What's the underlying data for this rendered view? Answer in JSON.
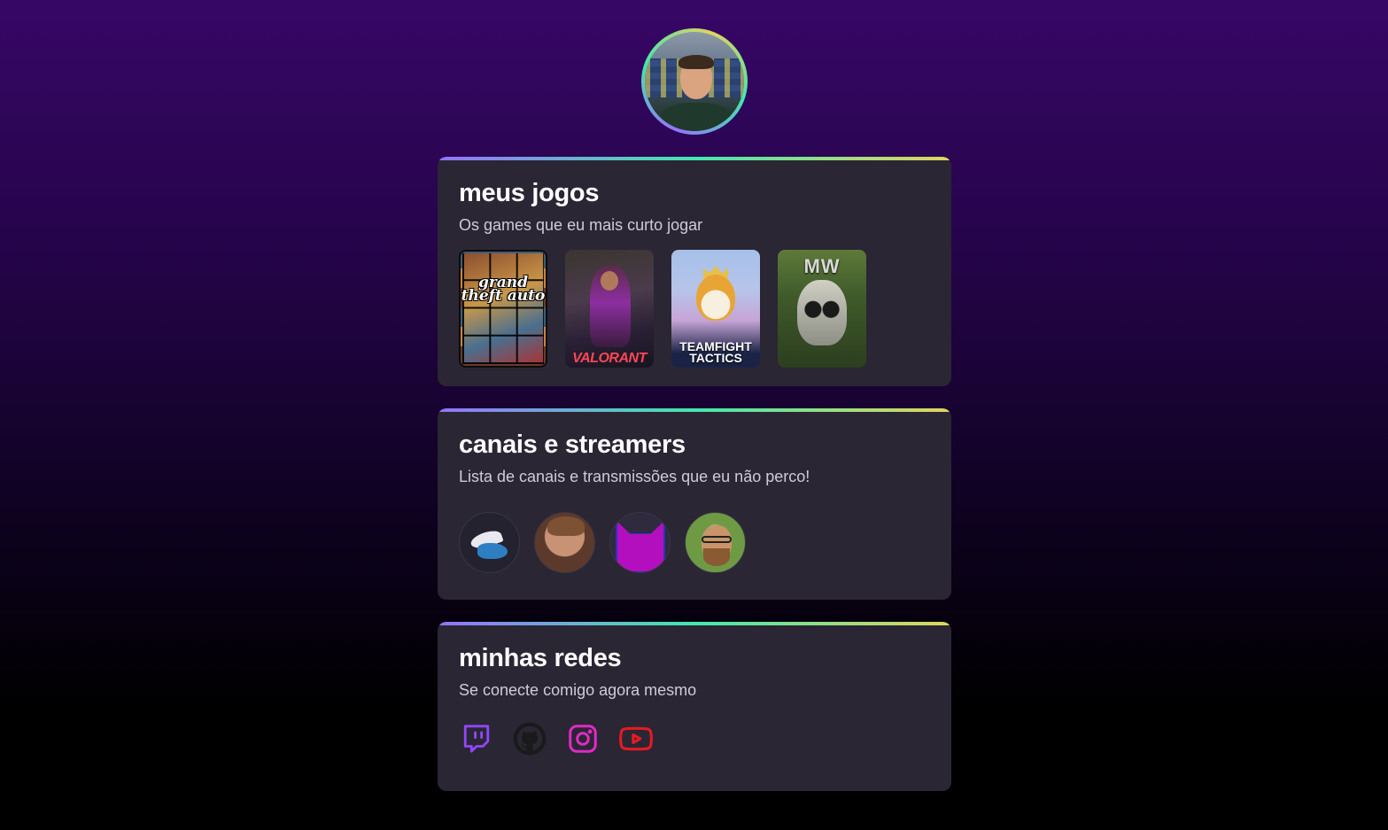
{
  "profile": {
    "avatar_alt": "profile-photo"
  },
  "games_section": {
    "title": "meus jogos",
    "subtitle": "Os games que eu mais curto jogar",
    "games": [
      {
        "name": "grand theft auto"
      },
      {
        "name": "VALORANT"
      },
      {
        "name": "TEAMFIGHT TACTICS"
      },
      {
        "name": "MW"
      }
    ]
  },
  "streamers_section": {
    "title": "canais e streamers",
    "subtitle": "Lista de canais e transmissões que eu não perco!"
  },
  "socials_section": {
    "title": "minhas redes",
    "subtitle": "Se conecte comigo agora mesmo",
    "links": [
      {
        "icon": "twitch-icon",
        "color": "#9146ff"
      },
      {
        "icon": "github-icon",
        "color": "#1a1a1a"
      },
      {
        "icon": "instagram-icon",
        "color": "#e12ac6"
      },
      {
        "icon": "youtube-icon",
        "color": "#e11b22"
      }
    ]
  },
  "colors": {
    "gradient_start": "#9572fc",
    "gradient_mid": "#43e7ad",
    "gradient_end": "#e1d55d",
    "card_bg": "#2a2634"
  }
}
